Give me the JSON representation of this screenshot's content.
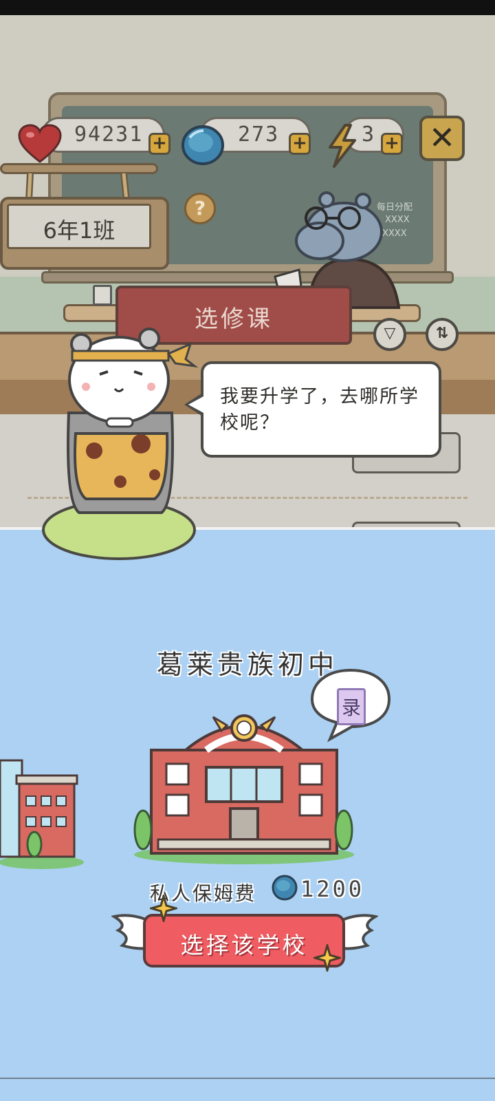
{
  "hud": {
    "hearts": "94231",
    "gems": "273",
    "energy": "3",
    "plus_label": "+",
    "close_label": "✕"
  },
  "classroom": {
    "class_sign": "6年1班",
    "help_label": "?",
    "elective_banner": "选修课",
    "filter_icon": "▽",
    "sort_icon": "⇅",
    "board_notes": [
      "每日分配",
      "XXXX",
      "XXXX"
    ]
  },
  "dialog": {
    "text": "我要升学了，去哪所学校呢？"
  },
  "school": {
    "name": "葛莱贵族初中",
    "badge": "录",
    "cost_label": "私人保姆费",
    "cost_value": "1200",
    "select_button": "选择该学校"
  },
  "colors": {
    "sky_blue": "#acd1f3",
    "button_red": "#ef5c62",
    "gold": "#d7a73e",
    "heart_red": "#c63a3a",
    "gem_blue": "#3f86b0"
  }
}
